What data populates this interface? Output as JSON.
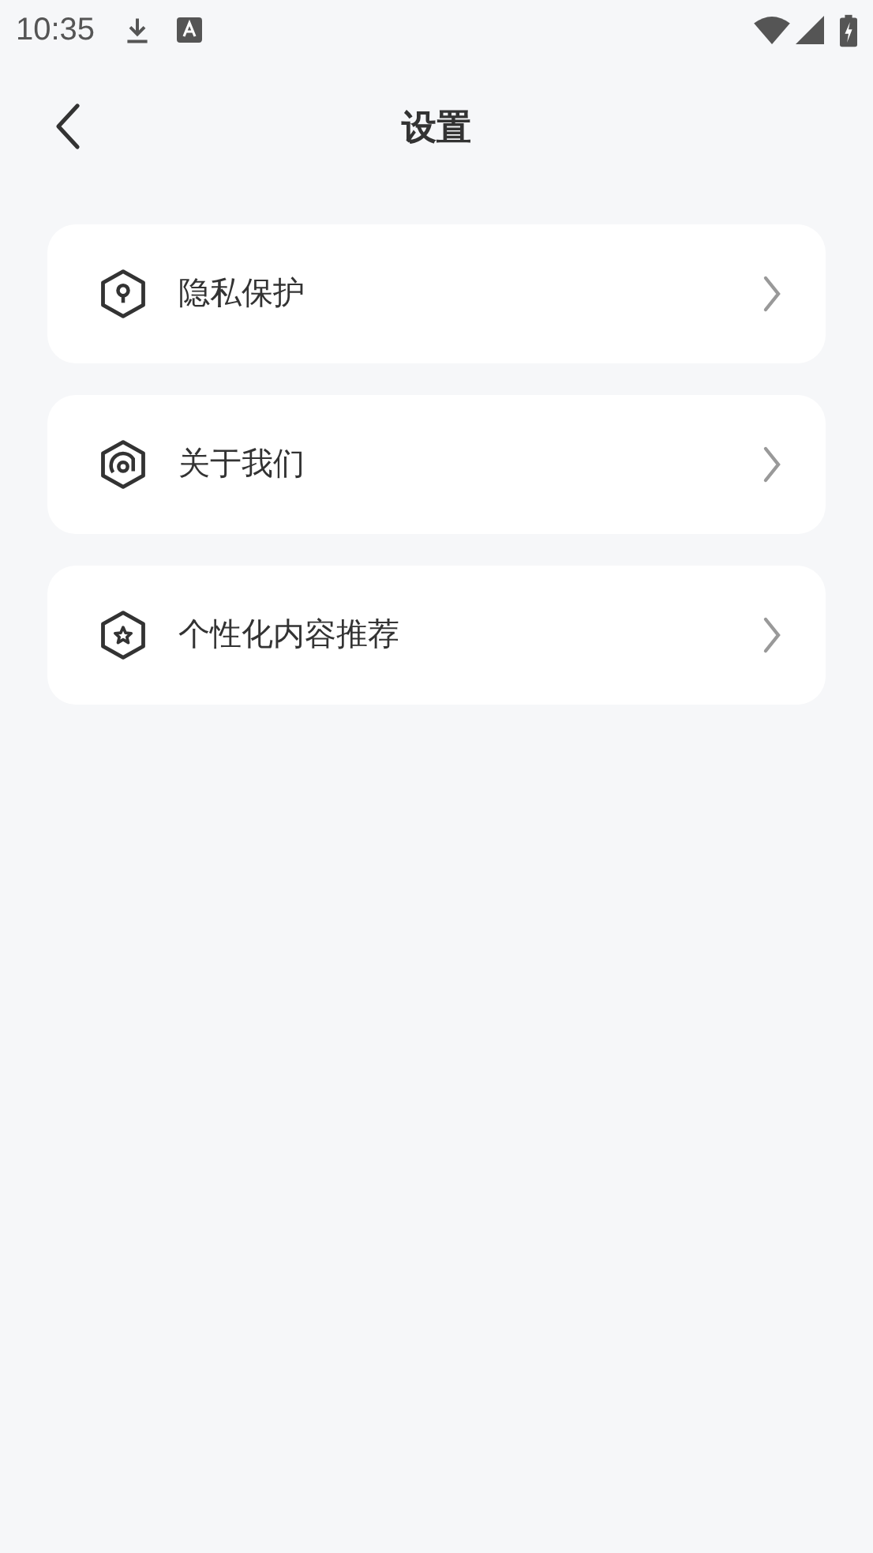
{
  "status_bar": {
    "time": "10:35"
  },
  "header": {
    "title": "设置"
  },
  "items": [
    {
      "label": "隐私保护",
      "kind": "lock"
    },
    {
      "label": "关于我们",
      "kind": "about"
    },
    {
      "label": "个性化内容推荐",
      "kind": "star"
    }
  ]
}
